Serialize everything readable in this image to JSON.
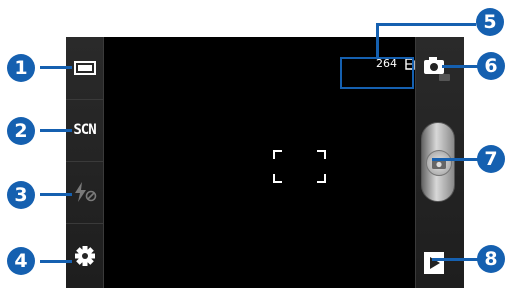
{
  "camera": {
    "left_bar": {
      "items": [
        {
          "icon": "shooting-mode-icon",
          "label": ""
        },
        {
          "icon": "scene-icon",
          "label": "SCN"
        },
        {
          "icon": "flash-off-icon",
          "label": ""
        },
        {
          "icon": "settings-gear-icon",
          "label": ""
        }
      ]
    },
    "storage": {
      "remaining_shots": "264",
      "icon": "memory-card-icon"
    },
    "right_bar": {
      "mode_icon": "camera-icon",
      "shutter_icon": "camera-icon",
      "gallery_icon": "play-icon"
    }
  },
  "callouts": [
    "1",
    "2",
    "3",
    "4",
    "5",
    "6",
    "7",
    "8"
  ],
  "colors": {
    "callout": "#1560b0",
    "bar_background": "#252525",
    "viewfinder": "#000000"
  }
}
